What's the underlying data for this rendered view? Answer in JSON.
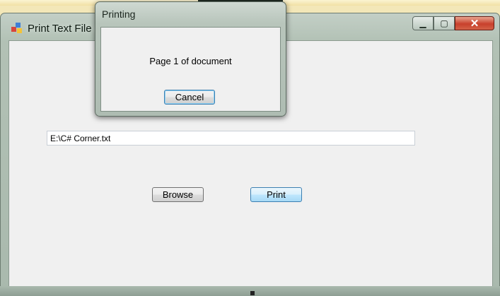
{
  "main_window": {
    "title": "Print Text File in C#",
    "caption_buttons": {
      "minimize": "▁",
      "maximize": "▢",
      "close": "✕"
    },
    "file_path": "E:\\C# Corner.txt",
    "browse_label": "Browse",
    "print_label": "Print"
  },
  "printing_dialog": {
    "title": "Printing",
    "status": "Page 1 of document",
    "cancel_label": "Cancel"
  },
  "icons": {
    "app": "app-icon"
  },
  "colors": {
    "close_button": "#c8402c",
    "print_button_border": "#3c7fb1",
    "client_bg": "#f0f0f0"
  }
}
